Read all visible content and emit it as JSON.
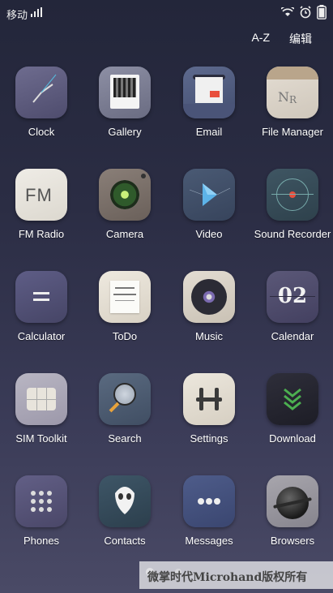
{
  "status_bar": {
    "carrier": "移动"
  },
  "top_actions": {
    "sort": "A-Z",
    "edit": "编辑"
  },
  "apps": [
    {
      "label": "Clock"
    },
    {
      "label": "Gallery"
    },
    {
      "label": "Email"
    },
    {
      "label": "File Manager"
    },
    {
      "label": "FM Radio",
      "icon_text": "FM"
    },
    {
      "label": "Camera"
    },
    {
      "label": "Video"
    },
    {
      "label": "Sound Recorder"
    },
    {
      "label": "Calculator"
    },
    {
      "label": "ToDo"
    },
    {
      "label": "Music"
    },
    {
      "label": "Calendar",
      "icon_text": "02"
    },
    {
      "label": "SIM Toolkit"
    },
    {
      "label": "Search"
    },
    {
      "label": "Settings"
    },
    {
      "label": "Download"
    },
    {
      "label": "Phones"
    },
    {
      "label": "Contacts"
    },
    {
      "label": "Messages"
    },
    {
      "label": "Browsers"
    }
  ],
  "watermark": "微掌时代Microhand版权所有",
  "colors": {
    "background": "#2b2d44",
    "accent_red": "#e84f3d",
    "download_green": "#4caf50"
  }
}
